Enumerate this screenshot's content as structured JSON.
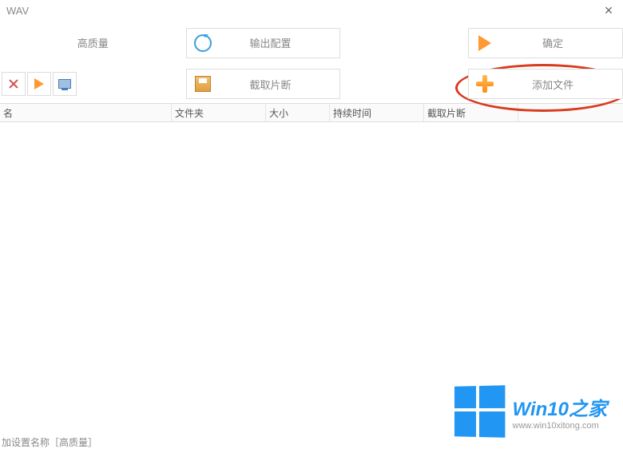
{
  "titlebar": {
    "title": "WAV"
  },
  "toolbar": {
    "quality_label": "高质量",
    "output_config_label": "输出配置",
    "confirm_label": "确定",
    "clip_label": "截取片断",
    "add_file_label": "添加文件"
  },
  "table": {
    "columns": [
      "名",
      "文件夹",
      "大小",
      "持续时间",
      "截取片断",
      ""
    ]
  },
  "footer": {
    "settings_text": "加设置名称［高质量］"
  },
  "watermark": {
    "title": "Win10之家",
    "url": "www.win10xitong.com"
  }
}
